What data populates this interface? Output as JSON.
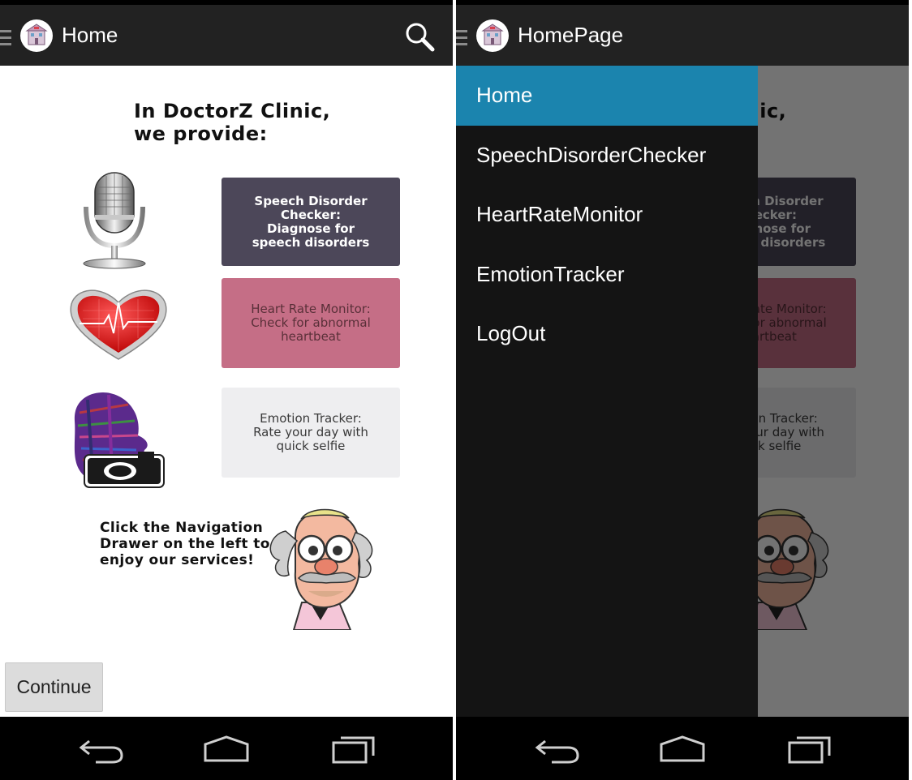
{
  "left": {
    "title": "Home",
    "intro": [
      "In DoctorZ Clinic,",
      "we provide:"
    ],
    "cards": [
      {
        "text": "Speech Disorder\nChecker:\nDiagnose for\nspeech disorders"
      },
      {
        "text": "Heart Rate Monitor:\nCheck for abnormal\nheartbeat"
      },
      {
        "text": "Emotion Tracker:\nRate your day with\nquick selfie"
      }
    ],
    "hint": "Click the Navigation\nDrawer on the left to\nenjoy our services!",
    "continue_label": "Continue"
  },
  "right": {
    "title": "HomePage",
    "drawer_items": [
      "Home",
      "SpeechDisorderChecker",
      "HeartRateMonitor",
      "EmotionTracker",
      "LogOut"
    ],
    "selected_item": "Home"
  },
  "colors": {
    "action_bar": "#222222",
    "drawer_bg": "#141414",
    "drawer_selected": "#1b84ae",
    "card_speech": "#4c4759",
    "card_heart": "#c56e86",
    "card_emotion": "#eeeef0"
  },
  "icons": [
    "hamburger-icon",
    "clinic-app-icon",
    "search-icon",
    "microphone-icon",
    "heart-rate-icon",
    "face-camera-icon",
    "doctor-cartoon",
    "back-icon",
    "home-icon",
    "recent-apps-icon"
  ]
}
